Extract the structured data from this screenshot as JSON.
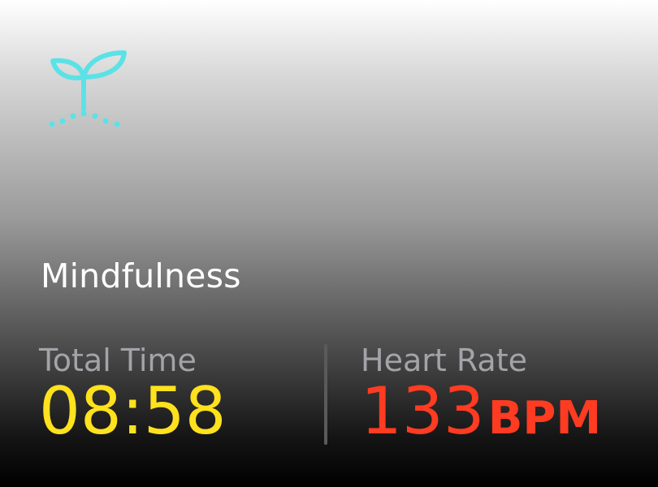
{
  "app": {
    "icon": "sprout-icon",
    "accent_color": "#5ce2e6",
    "title": "Mindfulness"
  },
  "metrics": {
    "total_time": {
      "label": "Total Time",
      "value": "08:58",
      "color": "#ffe21d"
    },
    "heart_rate": {
      "label": "Heart Rate",
      "value": "133",
      "unit": "BPM",
      "color": "#ff3b21"
    }
  }
}
